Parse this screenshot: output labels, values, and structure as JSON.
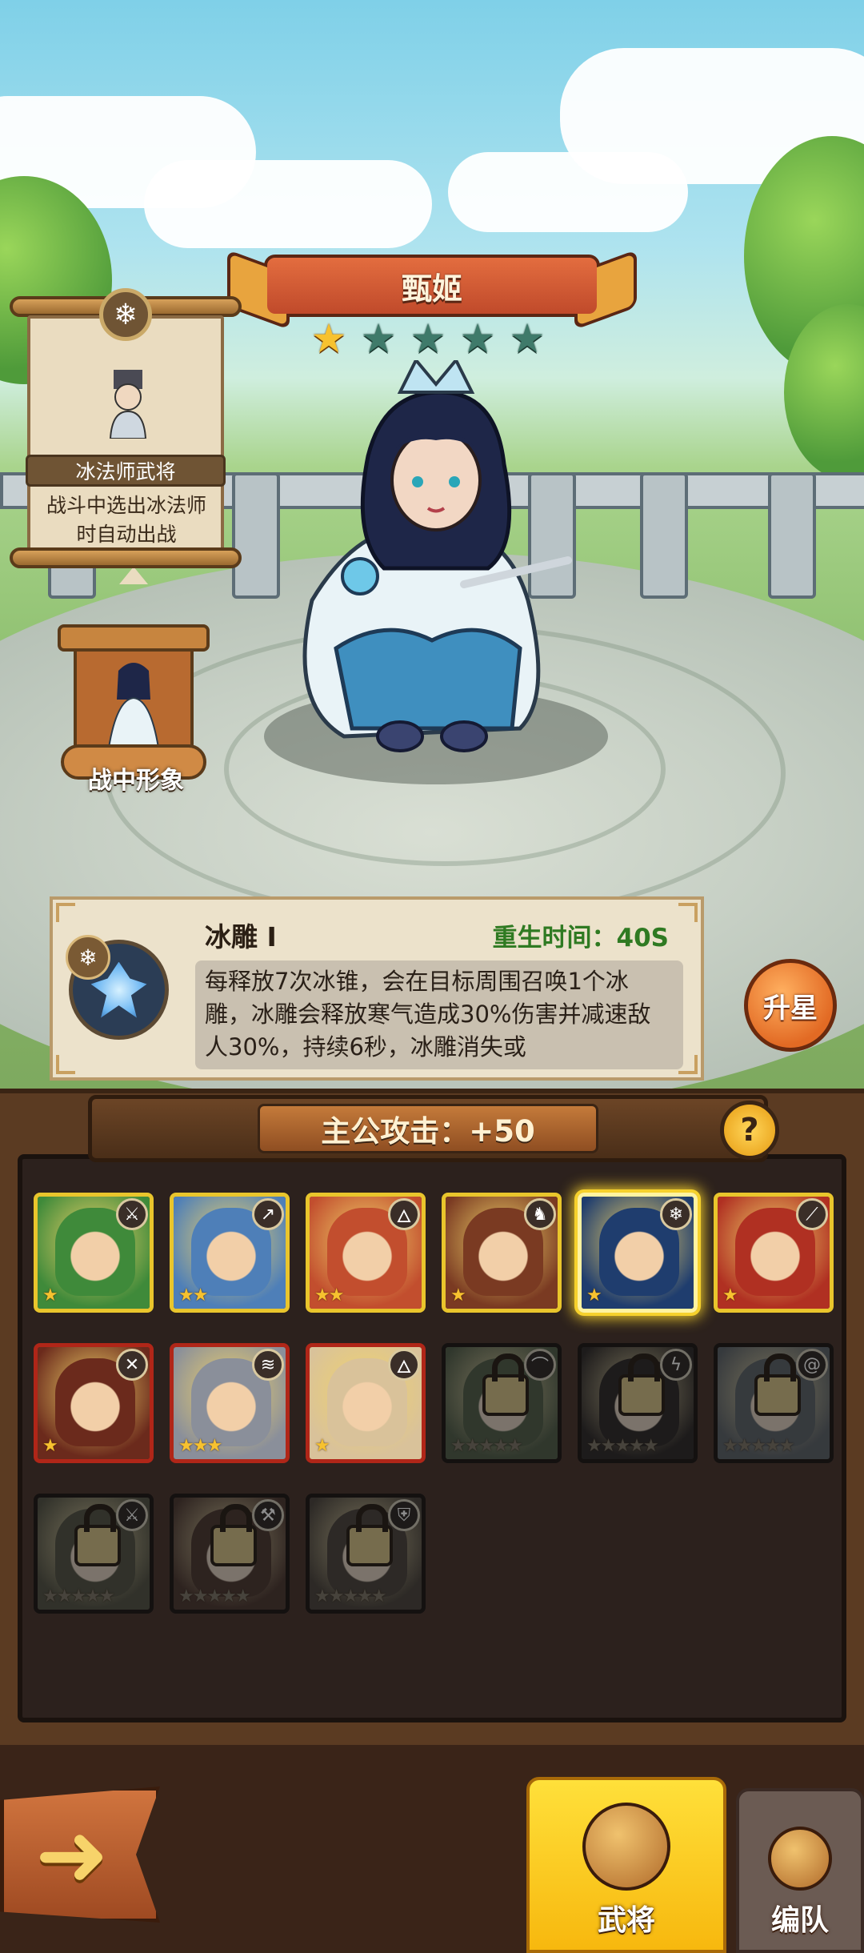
{
  "hero": {
    "name": "甄姬",
    "stars_filled": 1,
    "stars_total": 5
  },
  "role_card": {
    "icon": "snowflake-icon",
    "title": "冰法师武将",
    "description": "战斗中选出冰法师时自动出战"
  },
  "battle_look": {
    "label": "战中形象"
  },
  "skill": {
    "name": "冰雕 Ⅰ",
    "respawn": "重生时间：40S",
    "description": "每释放7次冰锥，会在目标周围召唤1个冰雕，冰雕会释放寒气造成30%伤害并减速敌人30%，持续6秒，冰雕消失或"
  },
  "upgrade_button": {
    "label": "升星"
  },
  "attack_banner": {
    "text": "主公攻击：+50"
  },
  "help_button": {
    "label": "?"
  },
  "roster": [
    {
      "frame": "gold",
      "icon": "sword-icon",
      "stars": 1,
      "locked": false,
      "selected": false,
      "bg": "#3f8a3a"
    },
    {
      "frame": "gold",
      "icon": "spear-icon",
      "stars": 2,
      "locked": false,
      "selected": false,
      "bg": "#4e7fb8"
    },
    {
      "frame": "gold",
      "icon": "fire-icon",
      "stars": 2,
      "locked": false,
      "selected": false,
      "bg": "#c24e2e"
    },
    {
      "frame": "gold",
      "icon": "horse-icon",
      "stars": 1,
      "locked": false,
      "selected": false,
      "bg": "#7a3a22"
    },
    {
      "frame": "gold",
      "icon": "snowflake-icon",
      "stars": 1,
      "locked": false,
      "selected": true,
      "bg": "#1f3d6e"
    },
    {
      "frame": "gold",
      "icon": "blade-icon",
      "stars": 1,
      "locked": false,
      "selected": false,
      "bg": "#b03022"
    },
    {
      "frame": "red",
      "icon": "crossed-swords-icon",
      "stars": 1,
      "locked": false,
      "selected": false,
      "bg": "#6b2a1c"
    },
    {
      "frame": "red",
      "icon": "claw-icon",
      "stars": 3,
      "locked": false,
      "selected": false,
      "bg": "#8a8f9a"
    },
    {
      "frame": "red",
      "icon": "fire-icon",
      "stars": 1,
      "locked": false,
      "selected": false,
      "bg": "#d9c29a"
    },
    {
      "frame": "locked",
      "icon": "bow-icon",
      "stars": 5,
      "locked": true,
      "selected": false,
      "bg": "#4a6a3a"
    },
    {
      "frame": "locked",
      "icon": "lightning-icon",
      "stars": 5,
      "locked": true,
      "selected": false,
      "bg": "#3a3030"
    },
    {
      "frame": "locked",
      "icon": "swirl-icon",
      "stars": 5,
      "locked": true,
      "selected": false,
      "bg": "#5a6a7a"
    },
    {
      "frame": "locked",
      "icon": "sword-icon",
      "stars": 5,
      "locked": true,
      "selected": false,
      "bg": "#5a5a3a"
    },
    {
      "frame": "locked",
      "icon": "axe-icon",
      "stars": 5,
      "locked": true,
      "selected": false,
      "bg": "#6a3a2a"
    },
    {
      "frame": "locked",
      "icon": "shield-icon",
      "stars": 5,
      "locked": true,
      "selected": false,
      "bg": "#5a4a3a"
    }
  ],
  "nav": {
    "back_icon": "back-arrow-icon",
    "tabs": [
      {
        "label": "武将",
        "icon": "general-icon",
        "active": true
      },
      {
        "label": "编队",
        "icon": "formation-icon",
        "active": false
      }
    ]
  }
}
